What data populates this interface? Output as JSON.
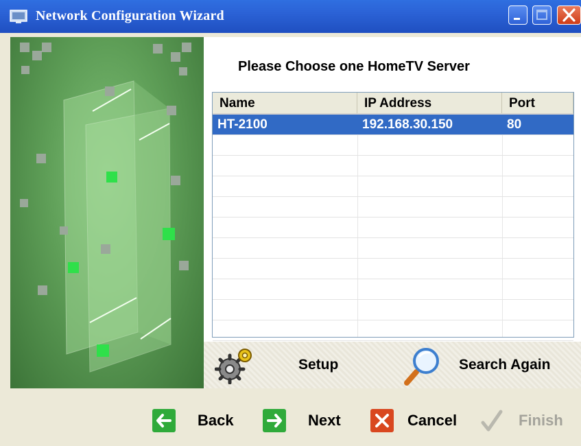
{
  "window": {
    "title": "Network Configuration Wizard",
    "colors": {
      "titlebar": "#2b62d6",
      "close": "#d9471f",
      "selection": "#316ac5",
      "side_panel": "#5e9e57"
    }
  },
  "main": {
    "heading": "Please Choose one HomeTV Server",
    "list": {
      "columns": [
        "Name",
        "IP Address",
        "Port"
      ],
      "rows": [
        {
          "name": "HT-2100",
          "ip": "192.168.30.150",
          "port": "80",
          "selected": true
        }
      ]
    },
    "actions": {
      "setup_label": "Setup",
      "search_label": "Search Again"
    }
  },
  "nav": {
    "back_label": "Back",
    "next_label": "Next",
    "cancel_label": "Cancel",
    "finish_label": "Finish",
    "finish_enabled": false
  },
  "icons": [
    "window-app-icon",
    "minimize-icon",
    "maximize-icon",
    "close-icon",
    "gears-icon",
    "magnifier-icon",
    "back-arrow-icon",
    "next-arrow-icon",
    "cancel-x-icon",
    "finish-check-icon"
  ]
}
